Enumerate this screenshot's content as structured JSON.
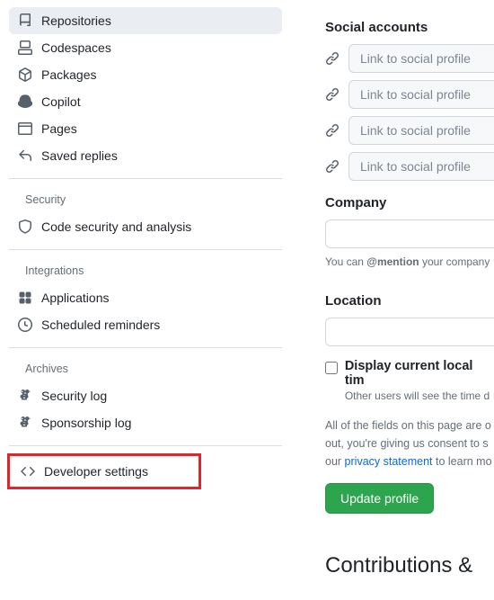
{
  "sidebar": {
    "items": [
      {
        "label": "Repositories"
      },
      {
        "label": "Codespaces"
      },
      {
        "label": "Packages"
      },
      {
        "label": "Copilot"
      },
      {
        "label": "Pages"
      },
      {
        "label": "Saved replies"
      }
    ],
    "security_title": "Security",
    "security_items": [
      {
        "label": "Code security and analysis"
      }
    ],
    "integrations_title": "Integrations",
    "integrations_items": [
      {
        "label": "Applications"
      },
      {
        "label": "Scheduled reminders"
      }
    ],
    "archives_title": "Archives",
    "archives_items": [
      {
        "label": "Security log"
      },
      {
        "label": "Sponsorship log"
      }
    ],
    "developer_settings": "Developer settings"
  },
  "main": {
    "social_accounts_title": "Social accounts",
    "social_placeholder": "Link to social profile",
    "company_title": "Company",
    "company_hint_pre": "You can ",
    "company_hint_mention": "@mention",
    "company_hint_post": " your company",
    "location_title": "Location",
    "display_time_label": "Display current local tim",
    "display_time_desc": "Other users will see the time d",
    "disclosure_pre": "All of the fields on this page are o",
    "disclosure_mid": "out, you're giving us consent to s",
    "disclosure_link": "privacy statement",
    "disclosure_post_our": "our ",
    "disclosure_post": " to learn mo",
    "update_button": "Update profile",
    "contributions_heading": "Contributions & "
  }
}
